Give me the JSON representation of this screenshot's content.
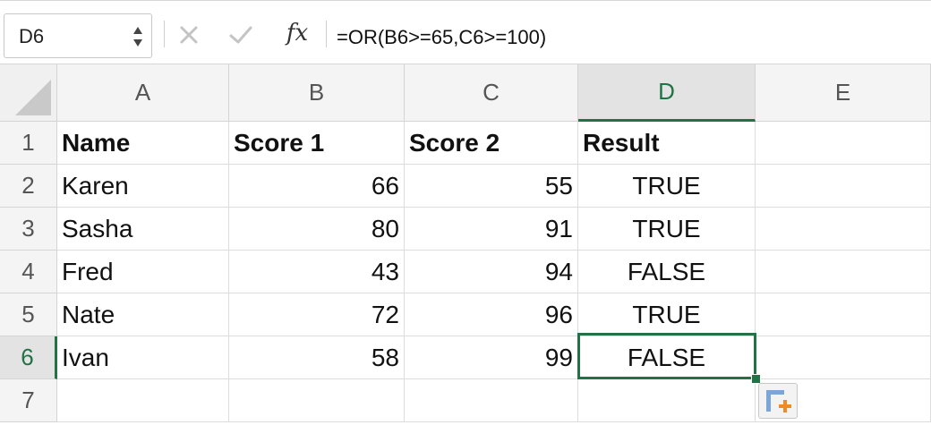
{
  "formula_bar": {
    "name_box": "D6",
    "fx_label": "fx",
    "formula": "=OR(B6>=65,C6>=100)"
  },
  "columns": [
    "A",
    "B",
    "C",
    "D",
    "E"
  ],
  "active_column": "D",
  "rows": [
    "1",
    "2",
    "3",
    "4",
    "5",
    "6",
    "7"
  ],
  "active_row": "6",
  "cells": {
    "r1": [
      "Name",
      "Score 1",
      "Score 2",
      "Result",
      ""
    ],
    "r2": [
      "Karen",
      "66",
      "55",
      "TRUE",
      ""
    ],
    "r3": [
      "Sasha",
      "80",
      "91",
      "TRUE",
      ""
    ],
    "r4": [
      "Fred",
      "43",
      "94",
      "FALSE",
      ""
    ],
    "r5": [
      "Nate",
      "72",
      "96",
      "TRUE",
      ""
    ],
    "r6": [
      "Ivan",
      "58",
      "99",
      "FALSE",
      ""
    ],
    "r7": [
      "",
      "",
      "",
      "",
      ""
    ]
  },
  "colors": {
    "accent": "#217346",
    "grid_line": "#dcdcdc",
    "header_bg": "#f4f4f4"
  },
  "icons": {
    "cancel": "close-icon",
    "enter": "check-icon",
    "function": "fx-icon",
    "quick_analysis": "quick-analysis-icon"
  }
}
